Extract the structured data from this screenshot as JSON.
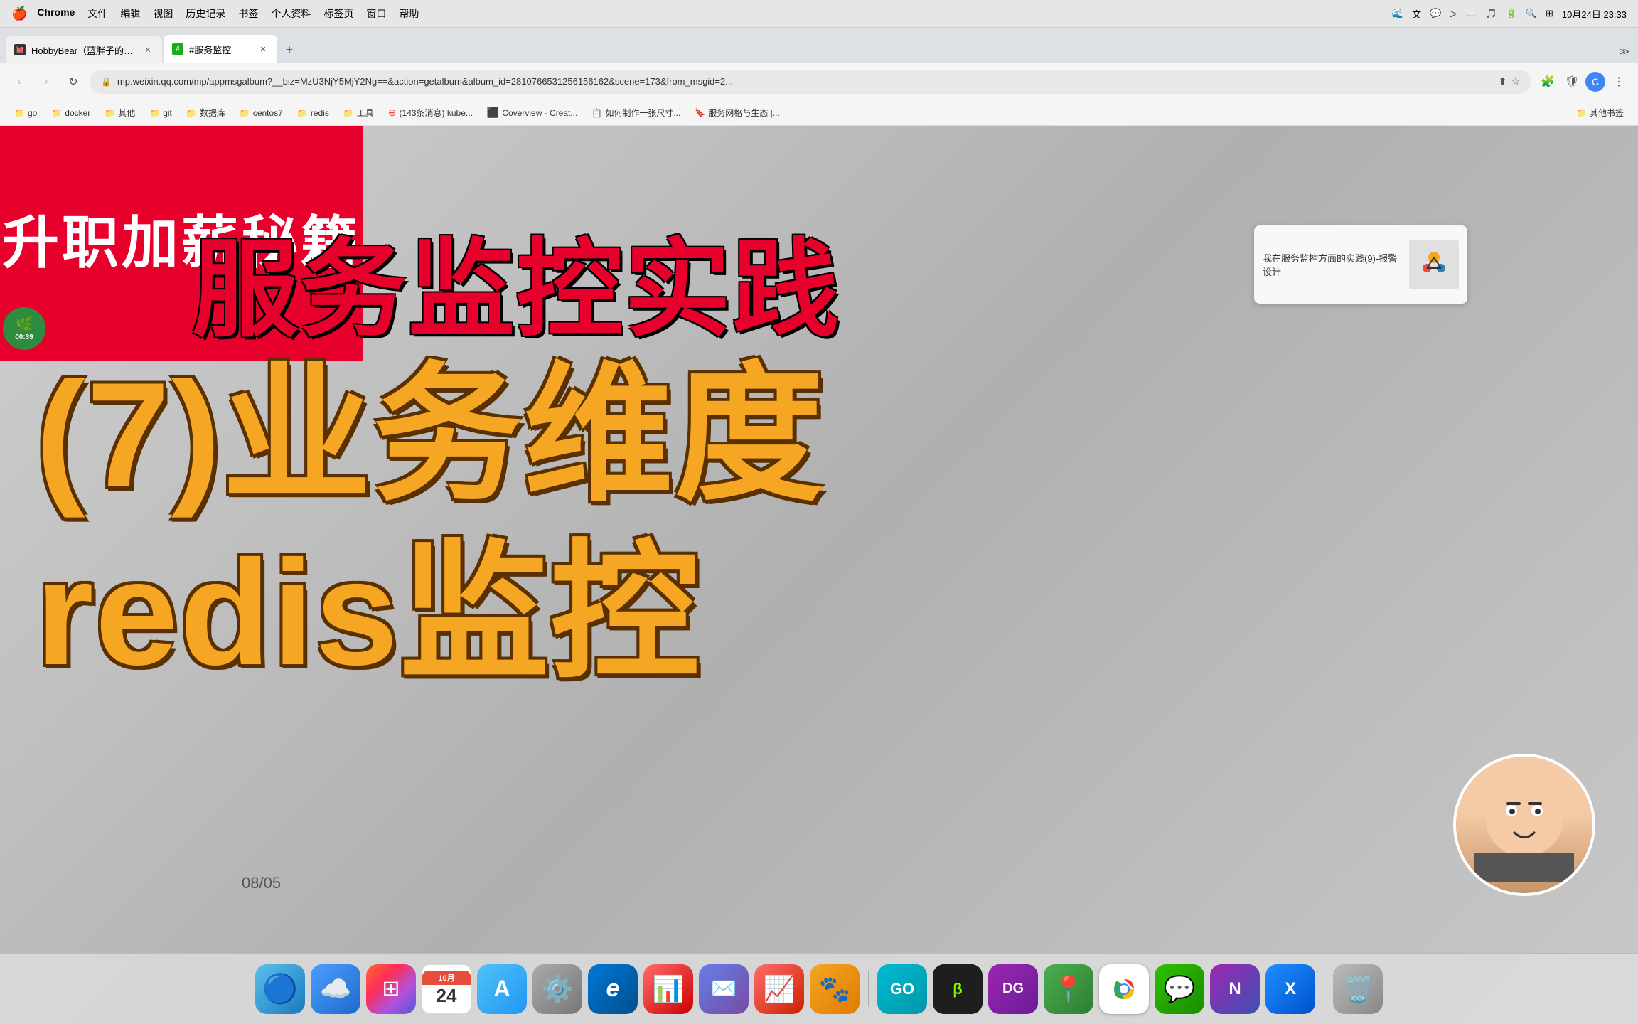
{
  "menubar": {
    "apple": "🍎",
    "app_name": "Chrome",
    "menu_items": [
      "文件",
      "编辑",
      "视图",
      "历史记录",
      "书签",
      "个人资料",
      "标签页",
      "窗口",
      "帮助"
    ],
    "time": "10月24日  23:33"
  },
  "tabs": [
    {
      "id": "tab1",
      "title": "HobbyBear（蓝胖子的编程梦）",
      "favicon_color": "#333",
      "active": false
    },
    {
      "id": "tab2",
      "title": "#服务监控",
      "favicon_color": "#1aad19",
      "active": true
    }
  ],
  "address_bar": {
    "url": "mp.weixin.qq.com/mp/appmsgalbum?__biz=MzU3NjY5MjY2Ng==&action=getalbum&album_id=2810766531256156162&scene=173&from_msgid=2...",
    "lock_icon": "🔒"
  },
  "bookmarks": [
    {
      "label": "go",
      "icon": "📁"
    },
    {
      "label": "docker",
      "icon": "📁"
    },
    {
      "label": "其他",
      "icon": "📁"
    },
    {
      "label": "git",
      "icon": "📁"
    },
    {
      "label": "数据库",
      "icon": "📁"
    },
    {
      "label": "centos7",
      "icon": "📁"
    },
    {
      "label": "redis",
      "icon": "📁"
    },
    {
      "label": "工具",
      "icon": "📁"
    },
    {
      "label": "(143条消息) kube...",
      "icon": "⭕"
    },
    {
      "label": "Coverview - Creat...",
      "icon": "🔵"
    },
    {
      "label": "如何制作一张尺寸...",
      "icon": "📋"
    },
    {
      "label": "服务网格与生态 |...",
      "icon": "🔖"
    },
    {
      "label": "其他书签",
      "icon": "📁"
    }
  ],
  "video": {
    "red_banner_text": "升职加薪秘籍",
    "title_service": "服务监控实践",
    "title_business": "(7)业务维度",
    "title_redis": "redis监控",
    "timer": "00:39",
    "article_title": "我在服务监控方面的实践(9)-报警设计",
    "date_stamp": "08/05"
  },
  "dock": {
    "items": [
      {
        "name": "finder",
        "label": "Finder",
        "emoji": "🔵",
        "css_class": "dock-finder"
      },
      {
        "name": "worktile",
        "label": "Worktile",
        "emoji": "☁️",
        "css_class": "dock-worktile"
      },
      {
        "name": "launchpad",
        "label": "Launchpad",
        "emoji": "⊞",
        "css_class": "dock-launchpad"
      },
      {
        "name": "calendar",
        "label": "日历",
        "emoji": "24",
        "css_class": "dock-calendar"
      },
      {
        "name": "appstore",
        "label": "App Store",
        "emoji": "A",
        "css_class": "dock-appstore"
      },
      {
        "name": "settings",
        "label": "系统偏好设置",
        "emoji": "⚙️",
        "css_class": "dock-settings"
      },
      {
        "name": "edge",
        "label": "Edge",
        "emoji": "e",
        "css_class": "dock-edge"
      },
      {
        "name": "keynote",
        "label": "Keynote",
        "emoji": "📊",
        "css_class": "dock-keynote"
      },
      {
        "name": "airmail",
        "label": "Airmail",
        "emoji": "✉️",
        "css_class": "dock-airmail"
      },
      {
        "name": "activity",
        "label": "活动监视器",
        "emoji": "📈",
        "css_class": "dock-activity"
      },
      {
        "name": "paw",
        "label": "Paw",
        "emoji": "🐾",
        "css_class": "dock-paw"
      },
      {
        "name": "goland",
        "label": "GoLand",
        "emoji": "GO",
        "css_class": "dock-goland"
      },
      {
        "name": "markdown",
        "label": "Markdown",
        "emoji": "M",
        "css_class": "dock-markdown"
      },
      {
        "name": "datagrip",
        "label": "DataGrip",
        "emoji": "DG",
        "css_class": "dock-datagrip"
      },
      {
        "name": "maps",
        "label": "地图",
        "emoji": "📍",
        "css_class": "dock-maps"
      },
      {
        "name": "chrome",
        "label": "Google Chrome",
        "emoji": "🌐",
        "css_class": "dock-chrome"
      },
      {
        "name": "wechat",
        "label": "微信",
        "emoji": "💬",
        "css_class": "dock-wechat"
      },
      {
        "name": "notchmeister",
        "label": "Notchmeister",
        "emoji": "N",
        "css_class": "dock-notchmeister"
      },
      {
        "name": "xcode",
        "label": "Xcode",
        "emoji": "X",
        "css_class": "dock-xcode"
      },
      {
        "name": "trash",
        "label": "废纸篓",
        "emoji": "🗑️",
        "css_class": "dock-trash"
      }
    ]
  }
}
